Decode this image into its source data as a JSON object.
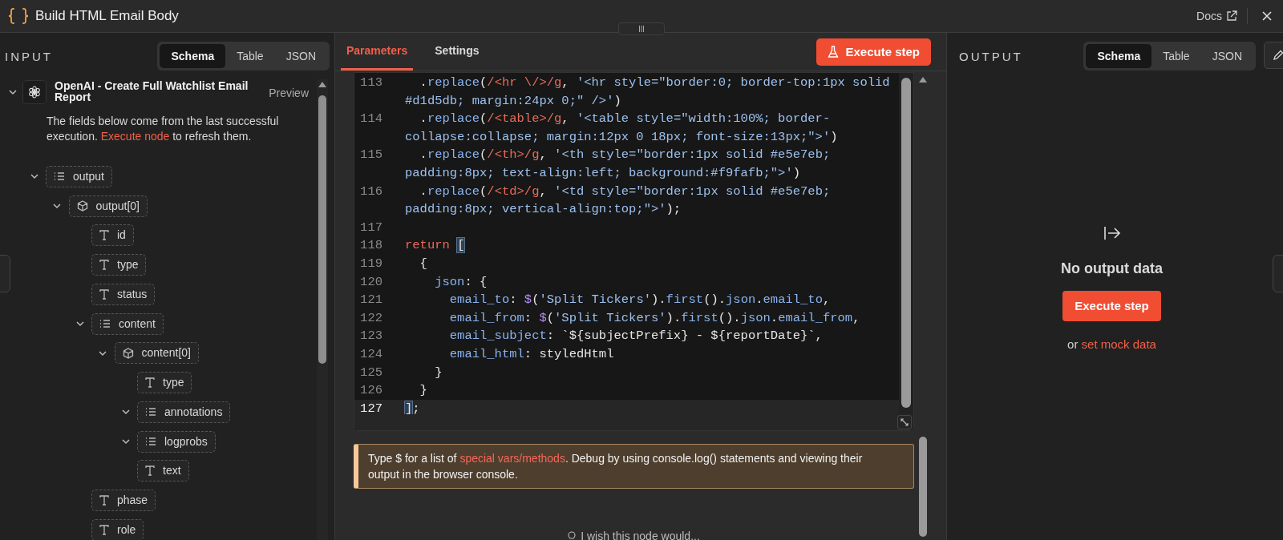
{
  "header": {
    "title": "Build HTML Email Body",
    "docs_link": "Docs"
  },
  "input": {
    "heading": "INPUT",
    "tabs": [
      {
        "label": "Schema",
        "selected": true
      },
      {
        "label": "Table",
        "selected": false
      },
      {
        "label": "JSON",
        "selected": false
      }
    ],
    "node": {
      "title": "OpenAI - Create Full Watchlist Email Report",
      "expanded": true,
      "preview": "Preview",
      "description": {
        "before": "The fields below come from the last successful execution.",
        "link": "Execute node",
        "after": "to refresh them."
      },
      "fields": [
        {
          "name": "output",
          "kind": "array",
          "expanded": true,
          "children": [
            {
              "name": "output[0]",
              "kind": "object",
              "expanded": true,
              "children": [
                {
                  "name": "id",
                  "kind": "string"
                },
                {
                  "name": "type",
                  "kind": "string"
                },
                {
                  "name": "status",
                  "kind": "string"
                },
                {
                  "name": "content",
                  "kind": "array",
                  "expanded": true,
                  "children": [
                    {
                      "name": "content[0]",
                      "kind": "object",
                      "expanded": true,
                      "children": [
                        {
                          "name": "type",
                          "kind": "string"
                        },
                        {
                          "name": "annotations",
                          "kind": "array",
                          "expanded": true
                        },
                        {
                          "name": "logprobs",
                          "kind": "array",
                          "expanded": true
                        },
                        {
                          "name": "text",
                          "kind": "string"
                        }
                      ]
                    }
                  ]
                },
                {
                  "name": "phase",
                  "kind": "string"
                },
                {
                  "name": "role",
                  "kind": "string"
                }
              ]
            }
          ]
        }
      ]
    }
  },
  "editor": {
    "tabs": [
      {
        "label": "Parameters",
        "selected": true
      },
      {
        "label": "Settings",
        "selected": false
      }
    ],
    "execute_button": "Execute step",
    "lines": [
      {
        "number": "113",
        "active": false,
        "segments": [
          {
            "kind": "plain",
            "text": "  ."
          },
          {
            "kind": "method",
            "text": "replace"
          },
          {
            "kind": "plain",
            "text": "("
          },
          {
            "kind": "regex",
            "text": "/<hr \\/>/g"
          },
          {
            "kind": "plain",
            "text": ", "
          },
          {
            "kind": "string",
            "text": "'<hr style=\"border:0; border-top:1px solid"
          }
        ],
        "continuation": [
          {
            "kind": "string",
            "text": "#d1d5db; margin:24px 0;\" />'"
          },
          {
            "kind": "plain",
            "text": ")"
          }
        ]
      },
      {
        "number": "114",
        "active": false,
        "segments": [
          {
            "kind": "plain",
            "text": "  ."
          },
          {
            "kind": "method",
            "text": "replace"
          },
          {
            "kind": "plain",
            "text": "("
          },
          {
            "kind": "regex",
            "text": "/<table>/g"
          },
          {
            "kind": "plain",
            "text": ", "
          },
          {
            "kind": "string",
            "text": "'<table style=\"width:100%; border-"
          }
        ],
        "continuation": [
          {
            "kind": "string",
            "text": "collapse:collapse; margin:12px 0 18px; font-size:13px;\">'"
          },
          {
            "kind": "plain",
            "text": ")"
          }
        ]
      },
      {
        "number": "115",
        "active": false,
        "segments": [
          {
            "kind": "plain",
            "text": "  ."
          },
          {
            "kind": "method",
            "text": "replace"
          },
          {
            "kind": "plain",
            "text": "("
          },
          {
            "kind": "regex",
            "text": "/<th>/g"
          },
          {
            "kind": "plain",
            "text": ", "
          },
          {
            "kind": "string",
            "text": "'<th style=\"border:1px solid #e5e7eb;"
          }
        ],
        "continuation": [
          {
            "kind": "string",
            "text": "padding:8px; text-align:left; background:#f9fafb;\">'"
          },
          {
            "kind": "plain",
            "text": ")"
          }
        ]
      },
      {
        "number": "116",
        "active": false,
        "segments": [
          {
            "kind": "plain",
            "text": "  ."
          },
          {
            "kind": "method",
            "text": "replace"
          },
          {
            "kind": "plain",
            "text": "("
          },
          {
            "kind": "regex",
            "text": "/<td>/g"
          },
          {
            "kind": "plain",
            "text": ", "
          },
          {
            "kind": "string",
            "text": "'<td style=\"border:1px solid #e5e7eb;"
          }
        ],
        "continuation": [
          {
            "kind": "string",
            "text": "padding:8px; vertical-align:top;\">'"
          },
          {
            "kind": "plain",
            "text": ");"
          }
        ]
      },
      {
        "number": "117",
        "active": false
      },
      {
        "number": "118",
        "active": false,
        "segments": [
          {
            "kind": "keyword",
            "text": "return "
          },
          {
            "kind": "match",
            "text": "["
          }
        ]
      },
      {
        "number": "119",
        "active": false,
        "segments": [
          {
            "kind": "plain",
            "text": "  {"
          }
        ]
      },
      {
        "number": "120",
        "active": false,
        "segments": [
          {
            "kind": "property",
            "text": "    json"
          },
          {
            "kind": "plain",
            "text": ": {"
          }
        ]
      },
      {
        "number": "121",
        "active": false,
        "segments": [
          {
            "kind": "property",
            "text": "      email_to"
          },
          {
            "kind": "plain",
            "text": ": "
          },
          {
            "kind": "variable",
            "text": "$"
          },
          {
            "kind": "plain",
            "text": "("
          },
          {
            "kind": "string",
            "text": "'Split Tickers'"
          },
          {
            "kind": "plain",
            "text": ")."
          },
          {
            "kind": "method",
            "text": "first"
          },
          {
            "kind": "plain",
            "text": "()."
          },
          {
            "kind": "method",
            "text": "json"
          },
          {
            "kind": "plain",
            "text": "."
          },
          {
            "kind": "method",
            "text": "email_to"
          },
          {
            "kind": "plain",
            "text": ","
          }
        ]
      },
      {
        "number": "122",
        "active": false,
        "segments": [
          {
            "kind": "property",
            "text": "      email_from"
          },
          {
            "kind": "plain",
            "text": ": "
          },
          {
            "kind": "variable",
            "text": "$"
          },
          {
            "kind": "plain",
            "text": "("
          },
          {
            "kind": "string",
            "text": "'Split Tickers'"
          },
          {
            "kind": "plain",
            "text": ")."
          },
          {
            "kind": "method",
            "text": "first"
          },
          {
            "kind": "plain",
            "text": "()."
          },
          {
            "kind": "method",
            "text": "json"
          },
          {
            "kind": "plain",
            "text": "."
          },
          {
            "kind": "method",
            "text": "email_from"
          },
          {
            "kind": "plain",
            "text": ","
          }
        ]
      },
      {
        "number": "123",
        "active": false,
        "segments": [
          {
            "kind": "property",
            "text": "      email_subject"
          },
          {
            "kind": "plain",
            "text": ": `${subjectPrefix} - ${reportDate}`,"
          }
        ]
      },
      {
        "number": "124",
        "active": false,
        "segments": [
          {
            "kind": "property",
            "text": "      email_html"
          },
          {
            "kind": "plain",
            "text": ": styledHtml"
          }
        ]
      },
      {
        "number": "125",
        "active": false,
        "segments": [
          {
            "kind": "plain",
            "text": "    }"
          }
        ]
      },
      {
        "number": "126",
        "active": false,
        "segments": [
          {
            "kind": "plain",
            "text": "  }"
          }
        ]
      },
      {
        "number": "127",
        "active": true,
        "segments": [
          {
            "kind": "match",
            "text": "]"
          },
          {
            "kind": "plain",
            "text": ";"
          }
        ]
      }
    ],
    "hint": {
      "before": "Type $ for a list of",
      "link": "special vars/methods",
      "after": ". Debug by using console.log() statements and viewing their output in the browser console."
    }
  },
  "feedback": "I wish this node would...",
  "output": {
    "heading": "OUTPUT",
    "tabs": [
      {
        "label": "Schema",
        "selected": true
      },
      {
        "label": "Table",
        "selected": false
      },
      {
        "label": "JSON",
        "selected": false
      }
    ],
    "empty_title": "No output data",
    "execute_button": "Execute step",
    "mock_prefix": "or",
    "mock_link": "set mock data"
  }
}
